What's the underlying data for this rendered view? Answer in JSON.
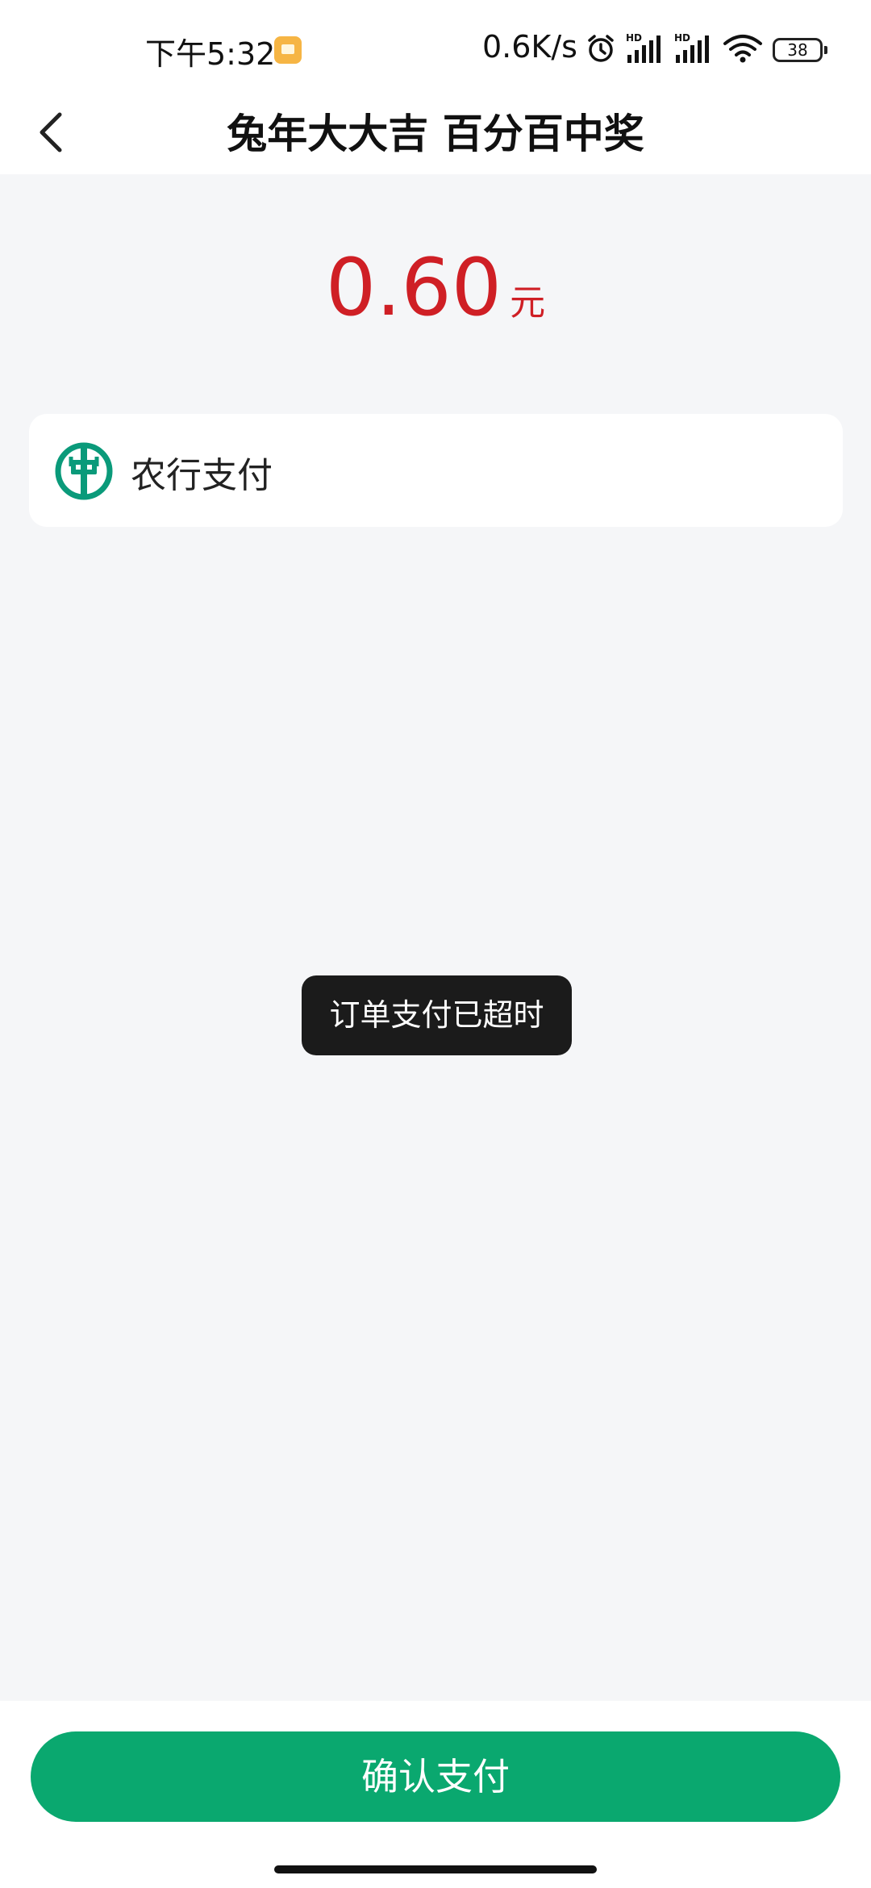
{
  "status_bar": {
    "time": "下午5:32",
    "net_speed": "0.6K/s",
    "signal_1_label": "HD",
    "signal_2_label": "HD",
    "battery": "38",
    "icons": [
      "app-notification-icon",
      "alarm-icon",
      "signal-hd-icon",
      "signal-hd-icon",
      "wifi-icon",
      "battery-icon"
    ]
  },
  "nav": {
    "back_icon": "back-arrow-icon",
    "title": "兔年大大吉 百分百中奖"
  },
  "amount": {
    "value": "0.60",
    "unit": "元",
    "color": "#cf1f25"
  },
  "payment_method": {
    "icon": "abc-bank-logo",
    "label": "农行支付",
    "brand_color": "#0a9a7a"
  },
  "toast": {
    "message": "订单支付已超时"
  },
  "confirm": {
    "label": "确认支付",
    "color": "#0aa86f"
  }
}
